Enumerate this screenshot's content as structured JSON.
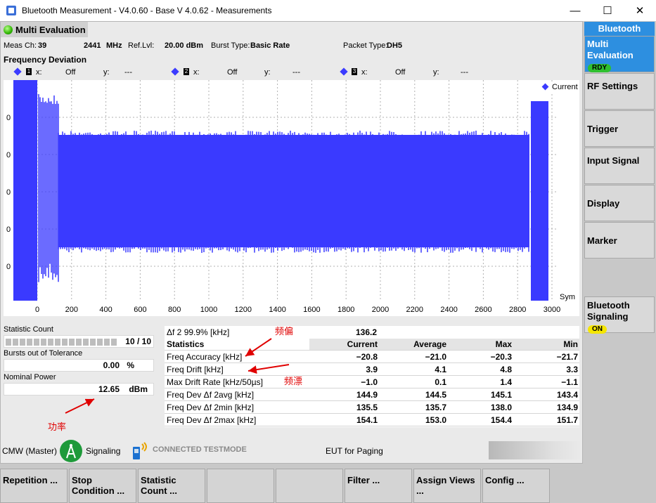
{
  "window": {
    "title": "Bluetooth Measurement  - V4.0.60 - Base V 4.0.62 - Measurements",
    "minimize": "—",
    "maximize": "☐",
    "close": "✕"
  },
  "header": {
    "title": "Multi Evaluation"
  },
  "meas": {
    "ch_label": "Meas Ch:",
    "ch_value": "39",
    "freq": "2441",
    "freq_unit": "MHz",
    "ref_label": "Ref.Lvl:",
    "ref_value": "20.00 dBm",
    "burst_label": "Burst Type:",
    "burst_value": "Basic Rate",
    "packet_label": "Packet Type:",
    "packet_value": "DH5"
  },
  "section_title": "Frequency Deviation",
  "markers": [
    {
      "x_label": "x:",
      "x_value": "Off",
      "y_label": "y:",
      "y_value": "---",
      "n": "1"
    },
    {
      "x_label": "x:",
      "x_value": "Off",
      "y_label": "y:",
      "y_value": "---",
      "n": "2"
    },
    {
      "x_label": "x:",
      "x_value": "Off",
      "y_label": "y:",
      "y_value": "---",
      "n": "3"
    }
  ],
  "chart_data": {
    "type": "area",
    "series": [
      {
        "name": "Current",
        "color": "#3a3aff"
      }
    ],
    "x_ticks": [
      "0",
      "200",
      "400",
      "600",
      "800",
      "1000",
      "1200",
      "1400",
      "1600",
      "1800",
      "2000",
      "2200",
      "2400",
      "2600",
      "2800",
      "3000"
    ],
    "x_unit": "Sym",
    "xlim": [
      0,
      3000
    ],
    "y_ticks": [
      "0",
      "0",
      "0",
      "0",
      "0"
    ],
    "grid": true,
    "legend": "top-right"
  },
  "left_stats": {
    "statistic_count_label": "Statistic Count",
    "statistic_count_value": "10 / 10",
    "bursts_label": "Bursts out of Tolerance",
    "bursts_value": "0.00",
    "bursts_unit": "%",
    "nominal_label": "Nominal Power",
    "nominal_value": "12.65",
    "nominal_unit": "dBm"
  },
  "results": {
    "df2_label": "Δf 2 99.9% [kHz]",
    "df2_value": "136.2",
    "stats_label": "Statistics",
    "columns": [
      "Current",
      "Average",
      "Max",
      "Min"
    ],
    "rows": [
      {
        "label": "Freq Accuracy [kHz]",
        "values": [
          "−20.8",
          "−21.0",
          "−20.3",
          "−21.7"
        ]
      },
      {
        "label": "Freq Drift [kHz]",
        "values": [
          "3.9",
          "4.1",
          "4.8",
          "3.3"
        ]
      },
      {
        "label": "Max Drift Rate [kHz/50µs]",
        "values": [
          "−1.0",
          "0.1",
          "1.4",
          "−1.1"
        ]
      },
      {
        "label": "Freq Dev Δf 2avg [kHz]",
        "values": [
          "144.9",
          "144.5",
          "145.1",
          "143.4"
        ]
      },
      {
        "label": "Freq Dev Δf 2min [kHz]",
        "values": [
          "135.5",
          "135.7",
          "138.0",
          "134.9"
        ]
      },
      {
        "label": "Freq Dev Δf 2max [kHz]",
        "values": [
          "154.1",
          "153.0",
          "154.4",
          "151.7"
        ]
      }
    ]
  },
  "annotations": {
    "freq_offset": "频偏",
    "freq_drift": "频漂",
    "power": "功率"
  },
  "status": {
    "cmw": "CMW (Master)",
    "signaling": "Signaling",
    "connected": "CONNECTED TESTMODE",
    "eut": "EUT for Paging"
  },
  "right_panel": {
    "header": "Bluetooth",
    "items": [
      {
        "label": "Multi Evaluation",
        "badge": "RDY"
      },
      {
        "label": "RF Settings"
      },
      {
        "label": "Trigger"
      },
      {
        "label": "Input Signal"
      },
      {
        "label": "Display"
      },
      {
        "label": "Marker"
      }
    ],
    "signaling": {
      "label": "Bluetooth Signaling",
      "badge": "ON"
    }
  },
  "bottom_bar": [
    "Repetition ...",
    "Stop Condition ...",
    "Statistic Count ...",
    "",
    "",
    "Filter ...",
    "Assign Views ...",
    "Config ..."
  ]
}
